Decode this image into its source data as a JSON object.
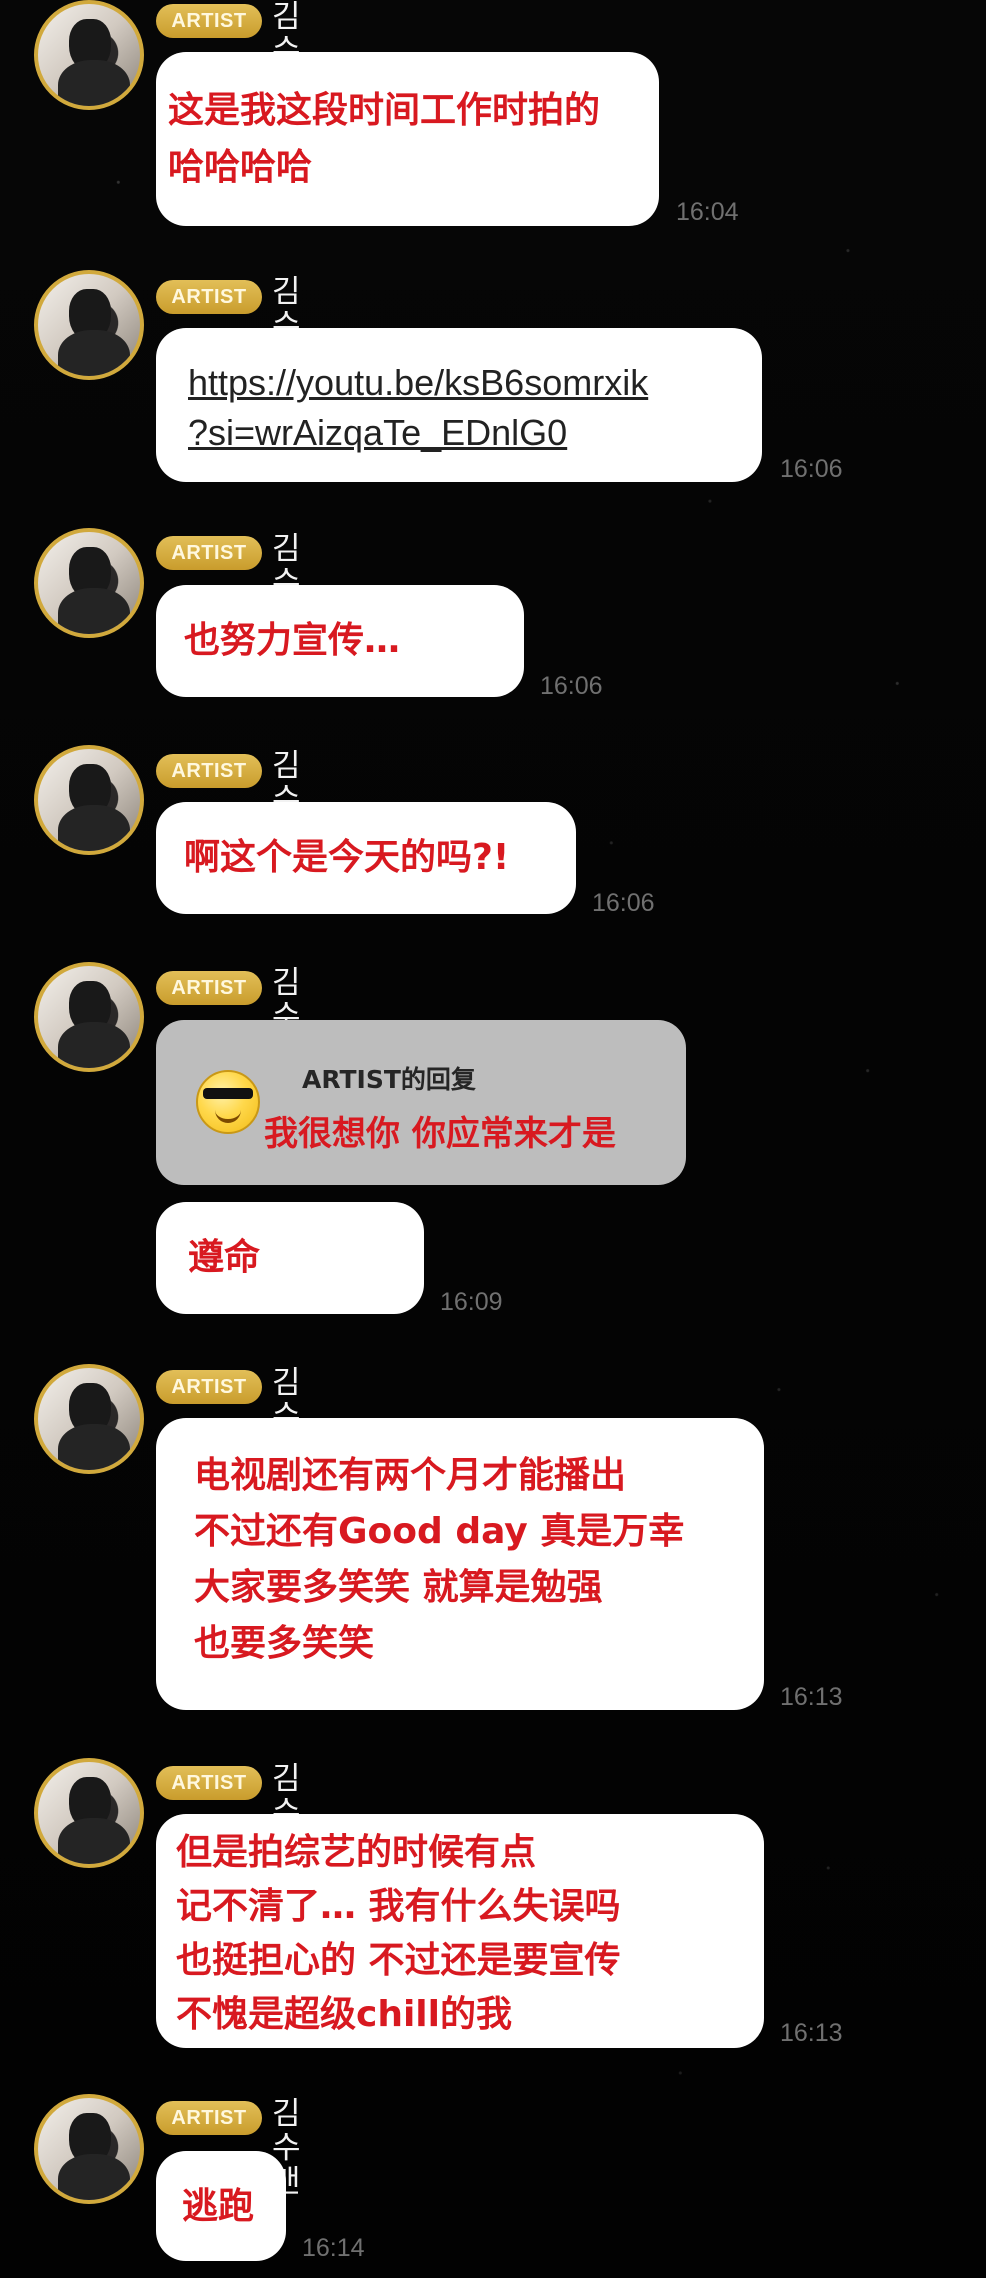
{
  "chat": {
    "messages": [
      {
        "sender_badge": "ARTIST",
        "sender_name": "김수맨",
        "lines": [
          "这是我这段时间工作时拍的",
          "哈哈哈哈"
        ],
        "time": "16:04"
      },
      {
        "sender_badge": "ARTIST",
        "sender_name": "김수맨",
        "link_lines": [
          "https://youtu.be/ksB6somrxik",
          "?si=wrAizqaTe_EDnlG0"
        ],
        "time": "16:06"
      },
      {
        "sender_badge": "ARTIST",
        "sender_name": "김수맨",
        "lines": [
          "也努力宣传…"
        ],
        "time": "16:06"
      },
      {
        "sender_badge": "ARTIST",
        "sender_name": "김수맨",
        "lines": [
          "啊这个是今天的吗?!"
        ],
        "time": "16:06"
      },
      {
        "sender_badge": "ARTIST",
        "sender_name": "김수맨",
        "reply": {
          "label": "ARTIST的回复",
          "text": "我很想你 你应常来才是"
        },
        "lines": [
          "遵命"
        ],
        "time": "16:09"
      },
      {
        "sender_badge": "ARTIST",
        "sender_name": "김수맨",
        "lines": [
          "电视剧还有两个月才能播出",
          "不过还有Good day 真是万幸",
          "大家要多笑笑 就算是勉强",
          "也要多笑笑"
        ],
        "time": "16:13"
      },
      {
        "sender_badge": "ARTIST",
        "sender_name": "김수맨",
        "lines": [
          "但是拍综艺的时候有点",
          "记不清了… 我有什么失误吗",
          "也挺担心的 不过还是要宣传",
          "不愧是超级chill的我"
        ],
        "time": "16:13"
      },
      {
        "sender_badge": "ARTIST",
        "sender_name": "김수맨",
        "lines": [
          "逃跑"
        ],
        "time": "16:14"
      }
    ]
  }
}
